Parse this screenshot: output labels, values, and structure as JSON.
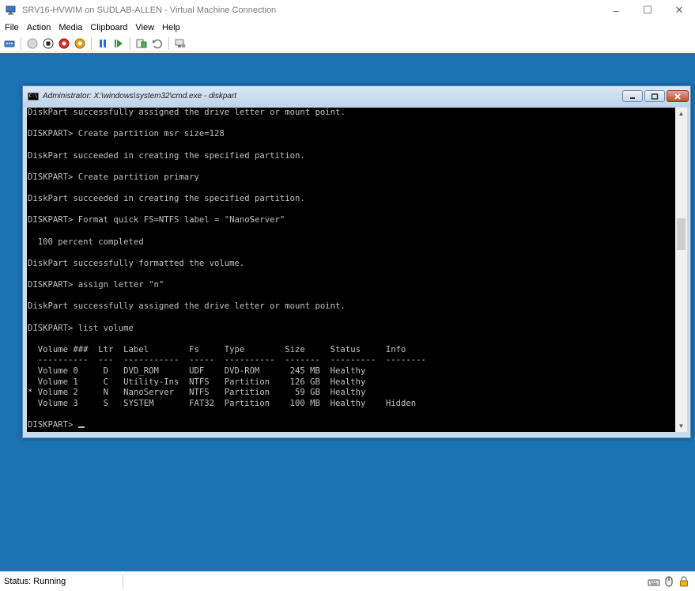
{
  "host": {
    "title": "SRV16-HVWIM on SUDLAB-ALLEN - Virtual Machine Connection",
    "menu": [
      "File",
      "Action",
      "Media",
      "Clipboard",
      "View",
      "Help"
    ],
    "controls": {
      "minimize": "–",
      "maximize": "☐",
      "close": "✕"
    }
  },
  "toolbar": {
    "icons": [
      "ctrl-alt-del-icon",
      "start-icon",
      "turn-off-icon",
      "shutdown-icon",
      "save-icon",
      "pause-icon",
      "reset-icon",
      "checkpoint-icon",
      "revert-icon",
      "enhanced-session-icon"
    ]
  },
  "cmd": {
    "title": "Administrator: X:\\windows\\system32\\cmd.exe - diskpart",
    "icon_text": "C:\\",
    "lines": [
      "DiskPart successfully assigned the drive letter or mount point.",
      "",
      "DISKPART> Create partition msr size=128",
      "",
      "DiskPart succeeded in creating the specified partition.",
      "",
      "DISKPART> Create partition primary",
      "",
      "DiskPart succeeded in creating the specified partition.",
      "",
      "DISKPART> Format quick FS=NTFS label = \"NanoServer\"",
      "",
      "  100 percent completed",
      "",
      "DiskPart successfully formatted the volume.",
      "",
      "DISKPART> assign letter \"n\"",
      "",
      "DiskPart successfully assigned the drive letter or mount point.",
      "",
      "DISKPART> list volume",
      "",
      "  Volume ###  Ltr  Label        Fs     Type        Size     Status     Info",
      "  ----------  ---  -----------  -----  ----------  -------  ---------  --------",
      "  Volume 0     D   DVD_ROM      UDF    DVD-ROM      245 MB  Healthy",
      "  Volume 1     C   Utility-Ins  NTFS   Partition    126 GB  Healthy",
      "* Volume 2     N   NanoServer   NTFS   Partition     59 GB  Healthy",
      "  Volume 3     S   SYSTEM       FAT32  Partition    100 MB  Healthy    Hidden",
      "",
      "DISKPART> "
    ]
  },
  "status": {
    "text": "Status: Running",
    "icons": [
      "keyboard-icon",
      "mouse-lock-icon",
      "padlock-icon"
    ]
  },
  "colors": {
    "desktop": "#1b73b3",
    "console_bg": "#000000",
    "console_fg": "#c0c0c0"
  }
}
